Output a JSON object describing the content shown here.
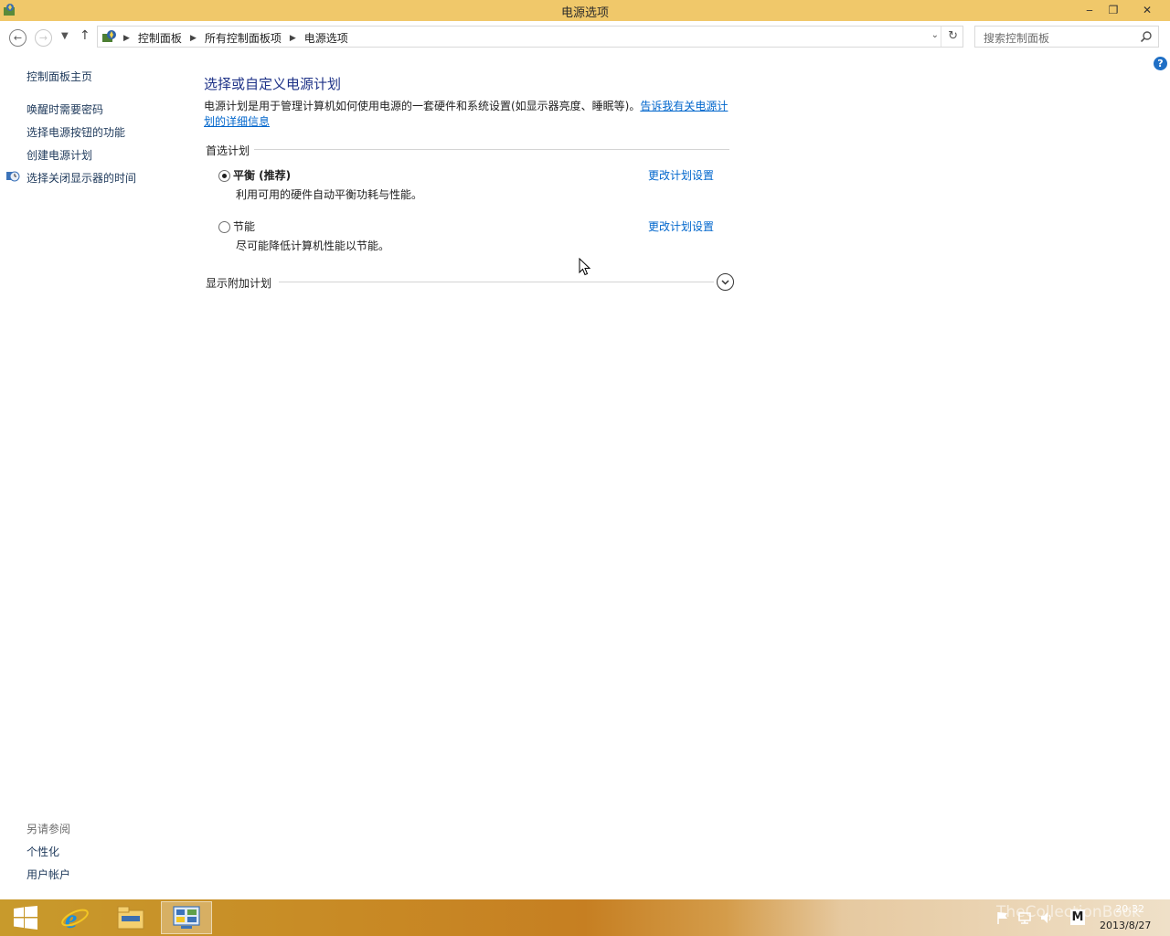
{
  "window": {
    "title": "电源选项",
    "controls": {
      "minimize": "‒",
      "restore": "❐",
      "close": "✕"
    }
  },
  "address": {
    "breadcrumbs": [
      "控制面板",
      "所有控制面板项",
      "电源选项"
    ],
    "search_placeholder": "搜索控制面板"
  },
  "sidebar": {
    "home": "控制面板主页",
    "links": [
      "唤醒时需要密码",
      "选择电源按钮的功能",
      "创建电源计划",
      "选择关闭显示器的时间"
    ],
    "see_also_title": "另请参阅",
    "see_also": [
      "个性化",
      "用户帐户"
    ]
  },
  "main": {
    "title": "选择或自定义电源计划",
    "description": "电源计划是用于管理计算机如何使用电源的一套硬件和系统设置(如显示器亮度、睡眠等)。",
    "description_link": "告诉我有关电源计划的详细信息",
    "preferred_heading": "首选计划",
    "plans": [
      {
        "name": "平衡 (推荐)",
        "desc": "利用可用的硬件自动平衡功耗与性能。",
        "link": "更改计划设置",
        "selected": true
      },
      {
        "name": "节能",
        "desc": "尽可能降低计算机性能以节能。",
        "link": "更改计划设置",
        "selected": false
      }
    ],
    "additional_heading": "显示附加计划"
  },
  "help": {
    "label": "?"
  },
  "taskbar": {
    "watermark": "TheCollectionBook",
    "time": "20:32",
    "date": "2013/8/27",
    "tray_letter": "M"
  },
  "colors": {
    "titlebar": "#f0c86a",
    "link": "#0066cc",
    "heading": "#1e3287",
    "sidebar_link": "#1e395b",
    "taskbar": "#c88a25"
  },
  "icons": [
    "app-icon",
    "back-arrow-icon",
    "forward-arrow-icon",
    "chevron-down-icon",
    "up-arrow-icon",
    "control-panel-icon",
    "refresh-icon",
    "search-icon",
    "shield-clock-icon",
    "chevron-circle-down-icon",
    "help-icon",
    "windows-start-icon",
    "ie-icon",
    "file-explorer-icon",
    "control-panel-taskbar-icon",
    "flag-icon",
    "network-icon",
    "speaker-icon"
  ]
}
